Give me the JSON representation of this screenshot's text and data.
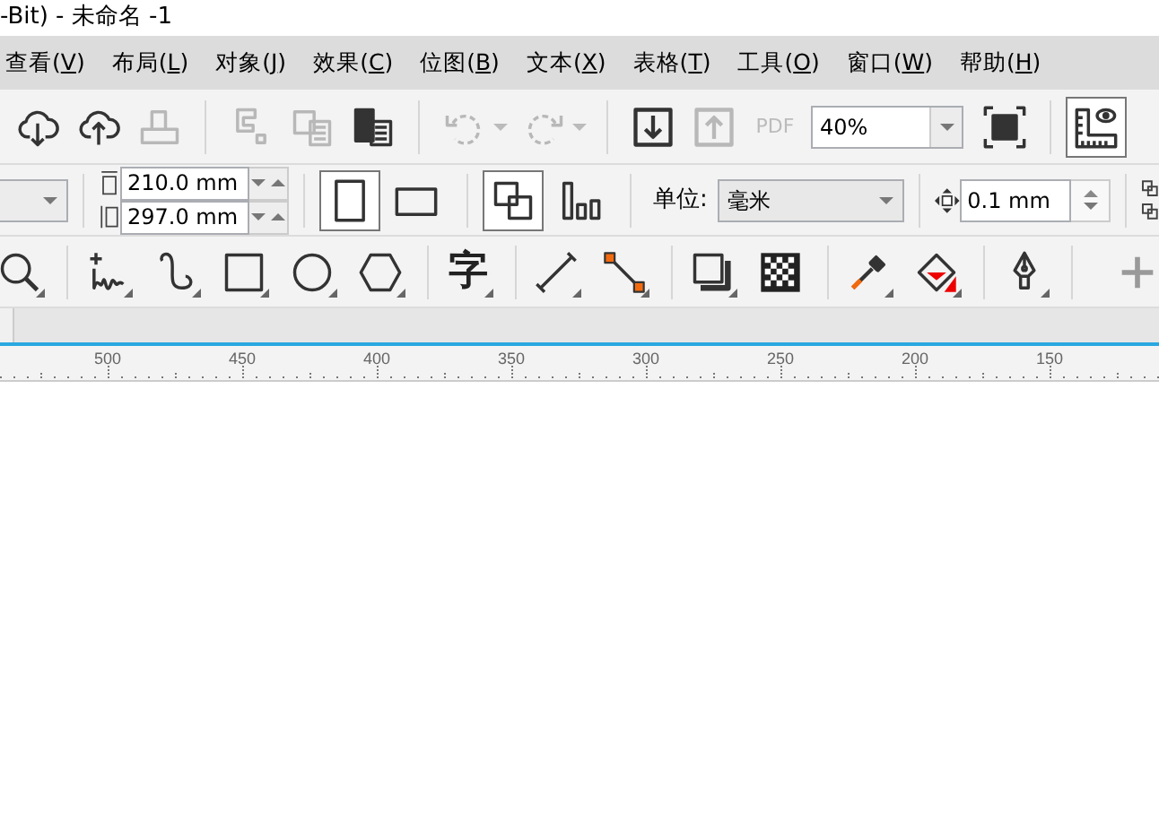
{
  "window": {
    "title": "-Bit) - 未命名 -1"
  },
  "menu": [
    {
      "label": "查看(V)"
    },
    {
      "label": "布局(L)"
    },
    {
      "label": "对象(J)"
    },
    {
      "label": "效果(C)"
    },
    {
      "label": "位图(B)"
    },
    {
      "label": "文本(X)"
    },
    {
      "label": "表格(T)"
    },
    {
      "label": "工具(O)"
    },
    {
      "label": "窗口(W)"
    },
    {
      "label": "帮助(H)"
    }
  ],
  "standard_toolbar": {
    "items": [
      {
        "kind": "cloud-download",
        "disabled": false
      },
      {
        "kind": "cloud-upload",
        "disabled": false
      },
      {
        "kind": "print",
        "disabled": true
      },
      {
        "kind": "separator"
      },
      {
        "kind": "cut",
        "disabled": true
      },
      {
        "kind": "copy",
        "disabled": true
      },
      {
        "kind": "paste",
        "disabled": false
      },
      {
        "kind": "separator"
      },
      {
        "kind": "undo",
        "disabled": true
      },
      {
        "kind": "redo",
        "disabled": true
      },
      {
        "kind": "separator"
      },
      {
        "kind": "import",
        "disabled": false
      },
      {
        "kind": "export",
        "disabled": true
      },
      {
        "kind": "pdf",
        "label": "PDF",
        "disabled": true
      },
      {
        "kind": "zoom",
        "value": "40%"
      },
      {
        "kind": "full-screen",
        "disabled": false
      },
      {
        "kind": "separator"
      },
      {
        "kind": "rulers",
        "disabled": false,
        "selected": true
      }
    ]
  },
  "property_bar": {
    "page_width": "210.0 mm",
    "page_height": "297.0 mm",
    "orientations": [
      {
        "kind": "portrait",
        "selected": true
      },
      {
        "kind": "landscape",
        "selected": false
      }
    ],
    "layouts": [
      {
        "kind": "all-pages",
        "selected": true
      },
      {
        "kind": "current-page",
        "selected": false
      }
    ],
    "units_label": "单位:",
    "units_value": "毫米",
    "nudge": "0.1 mm"
  },
  "toolbox": [
    {
      "kind": "zoom"
    },
    {
      "kind": "separator"
    },
    {
      "kind": "freehand"
    },
    {
      "kind": "curve"
    },
    {
      "kind": "rectangle"
    },
    {
      "kind": "ellipse"
    },
    {
      "kind": "polygon"
    },
    {
      "kind": "separator"
    },
    {
      "kind": "text",
      "label": "字"
    },
    {
      "kind": "separator"
    },
    {
      "kind": "dimension"
    },
    {
      "kind": "connector"
    },
    {
      "kind": "separator"
    },
    {
      "kind": "shadow"
    },
    {
      "kind": "transparency"
    },
    {
      "kind": "separator"
    },
    {
      "kind": "eyedropper"
    },
    {
      "kind": "fill"
    },
    {
      "kind": "separator"
    },
    {
      "kind": "pen"
    },
    {
      "kind": "separator"
    },
    {
      "kind": "add"
    }
  ],
  "ruler": {
    "labels": [
      "500",
      "450",
      "400",
      "350",
      "300",
      "250",
      "200",
      "150"
    ]
  }
}
